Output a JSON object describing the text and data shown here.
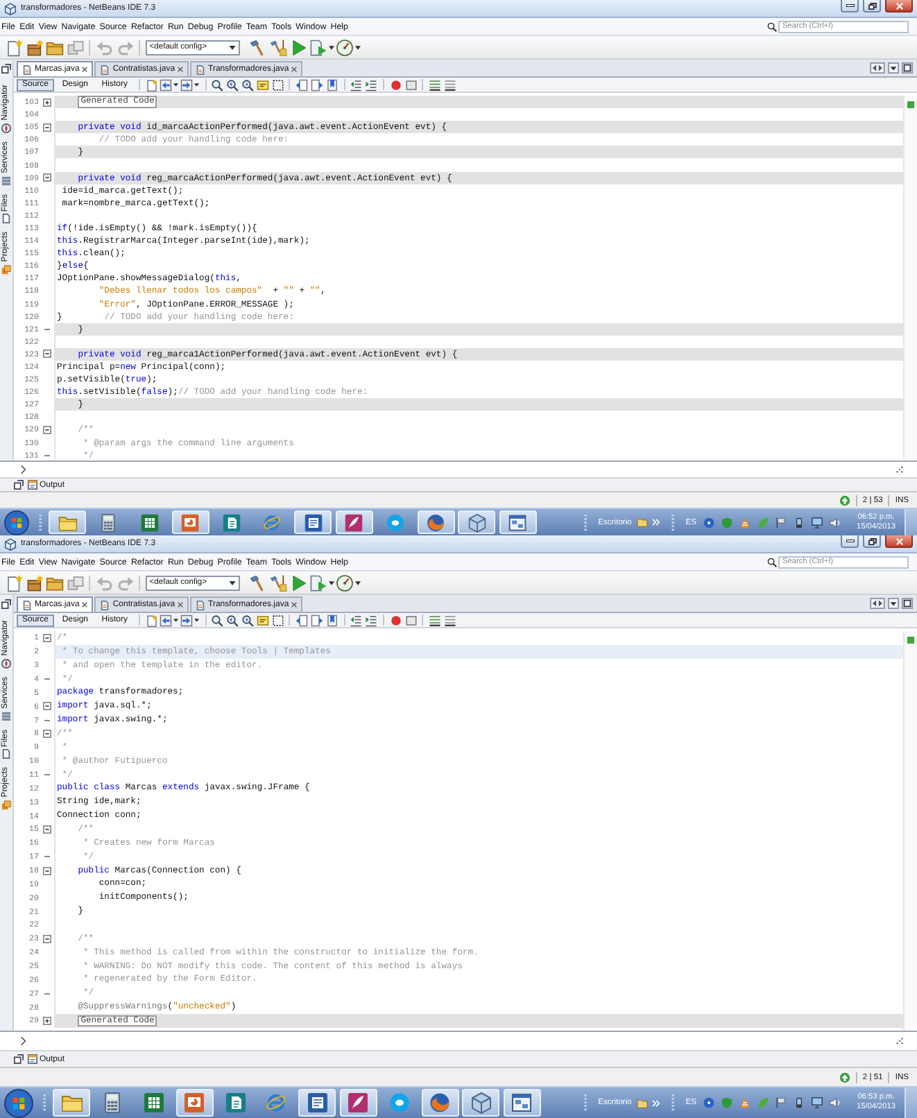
{
  "windows": [
    {
      "title": "transformadores - NetBeans IDE 7.3",
      "menu": [
        "File",
        "Edit",
        "View",
        "Navigate",
        "Source",
        "Refactor",
        "Run",
        "Debug",
        "Profile",
        "Team",
        "Tools",
        "Window",
        "Help"
      ],
      "search": {
        "placeholder": "Search (Ctrl+I)"
      },
      "config": "<default config>",
      "editor_tabs": [
        {
          "label": "Marcas.java",
          "selected": true
        },
        {
          "label": "Contratistas.java",
          "selected": false
        },
        {
          "label": "Transformadores.java",
          "selected": false
        }
      ],
      "views": [
        {
          "label": "Source",
          "selected": true
        },
        {
          "label": "Design",
          "selected": false
        },
        {
          "label": "History",
          "selected": false
        }
      ],
      "side_tabs": [
        "Navigator",
        "Services",
        "Files",
        "Projects"
      ],
      "code": [
        {
          "number": "103",
          "guarded": true,
          "fold": {
            "kind": "toggle",
            "expanded": false
          },
          "tokens": [
            {
              "kind": "folded",
              "text": "Generated Code"
            }
          ]
        },
        {
          "number": "104",
          "guarded": false
        },
        {
          "number": "105",
          "guarded": true,
          "fold": {
            "kind": "toggle",
            "expanded": true
          },
          "tokens": [
            {
              "kind": "keyword",
              "text": "    private void"
            },
            {
              "kind": "plain",
              "text": " id_marcaActionPerformed(java.awt.event.ActionEvent evt) {"
            }
          ]
        },
        {
          "number": "106",
          "guarded": false,
          "tokens": [
            {
              "kind": "comment",
              "text": "        // TODO add your handling code here:"
            }
          ]
        },
        {
          "number": "107",
          "guarded": true,
          "tokens": [
            {
              "kind": "plain",
              "text": "    }"
            }
          ]
        },
        {
          "number": "108",
          "guarded": false
        },
        {
          "number": "109",
          "guarded": true,
          "fold": {
            "kind": "toggle",
            "expanded": true
          },
          "tokens": [
            {
              "kind": "keyword",
              "text": "    private void"
            },
            {
              "kind": "plain",
              "text": " reg_marcaActionPerformed(java.awt.event.ActionEvent evt) {"
            }
          ]
        },
        {
          "number": "110",
          "guarded": false,
          "tokens": [
            {
              "kind": "plain",
              "text": " ide=id_marca.getText();"
            }
          ]
        },
        {
          "number": "111",
          "guarded": false,
          "tokens": [
            {
              "kind": "plain",
              "text": " mark=nombre_marca.getText();"
            }
          ]
        },
        {
          "number": "112",
          "guarded": false
        },
        {
          "number": "113",
          "guarded": false,
          "tokens": [
            {
              "kind": "keyword",
              "text": "if"
            },
            {
              "kind": "plain",
              "text": "(!ide.isEmpty() && !mark.isEmpty()){"
            }
          ]
        },
        {
          "number": "114",
          "guarded": false,
          "tokens": [
            {
              "kind": "keyword",
              "text": "this"
            },
            {
              "kind": "plain",
              "text": ".RegistrarMarca(Integer.parseInt(ide),mark);"
            }
          ]
        },
        {
          "number": "115",
          "guarded": false,
          "tokens": [
            {
              "kind": "keyword",
              "text": "this"
            },
            {
              "kind": "plain",
              "text": ".clean();"
            }
          ]
        },
        {
          "number": "116",
          "guarded": false,
          "tokens": [
            {
              "kind": "plain",
              "text": "}"
            },
            {
              "kind": "keyword",
              "text": "else"
            },
            {
              "kind": "plain",
              "text": "{"
            }
          ]
        },
        {
          "number": "117",
          "guarded": false,
          "tokens": [
            {
              "kind": "plain",
              "text": "JOptionPane.showMessageDialog("
            },
            {
              "kind": "keyword",
              "text": "this"
            },
            {
              "kind": "plain",
              "text": ","
            }
          ]
        },
        {
          "number": "118",
          "guarded": false,
          "tokens": [
            {
              "kind": "string",
              "text": "        \"Debes llenar todos los campos\""
            },
            {
              "kind": "plain",
              "text": "  + "
            },
            {
              "kind": "string",
              "text": "\"\""
            },
            {
              "kind": "plain",
              "text": " + "
            },
            {
              "kind": "string",
              "text": "\"\""
            },
            {
              "kind": "plain",
              "text": ","
            }
          ]
        },
        {
          "number": "119",
          "guarded": false,
          "tokens": [
            {
              "kind": "string",
              "text": "        \"Error\""
            },
            {
              "kind": "plain",
              "text": ", JOptionPane.ERROR_MESSAGE );"
            }
          ]
        },
        {
          "number": "120",
          "guarded": false,
          "tokens": [
            {
              "kind": "plain",
              "text": "}"
            },
            {
              "kind": "comment",
              "text": "        // TODO add your handling code here:"
            }
          ]
        },
        {
          "number": "121",
          "guarded": true,
          "fold": {
            "kind": "end"
          },
          "tokens": [
            {
              "kind": "plain",
              "text": "    }"
            }
          ]
        },
        {
          "number": "122",
          "guarded": false
        },
        {
          "number": "123",
          "guarded": true,
          "fold": {
            "kind": "toggle",
            "expanded": true
          },
          "tokens": [
            {
              "kind": "keyword",
              "text": "    private void"
            },
            {
              "kind": "plain",
              "text": " reg_marca1ActionPerformed(java.awt.event.ActionEvent evt) {"
            }
          ]
        },
        {
          "number": "124",
          "guarded": false,
          "tokens": [
            {
              "kind": "plain",
              "text": "Principal p="
            },
            {
              "kind": "keyword",
              "text": "new"
            },
            {
              "kind": "plain",
              "text": " Principal(conn);"
            }
          ]
        },
        {
          "number": "125",
          "guarded": false,
          "tokens": [
            {
              "kind": "plain",
              "text": "p.setVisible("
            },
            {
              "kind": "keyword",
              "text": "true"
            },
            {
              "kind": "plain",
              "text": ");"
            }
          ]
        },
        {
          "number": "126",
          "guarded": false,
          "tokens": [
            {
              "kind": "keyword",
              "text": "this"
            },
            {
              "kind": "plain",
              "text": ".setVisible("
            },
            {
              "kind": "keyword",
              "text": "false"
            },
            {
              "kind": "plain",
              "text": ");"
            },
            {
              "kind": "comment",
              "text": "// TODO add your handling code here:"
            }
          ]
        },
        {
          "number": "127",
          "guarded": true,
          "tokens": [
            {
              "kind": "plain",
              "text": "    }"
            }
          ]
        },
        {
          "number": "128",
          "guarded": false
        },
        {
          "number": "129",
          "guarded": false,
          "fold": {
            "kind": "toggle",
            "expanded": true
          },
          "tokens": [
            {
              "kind": "comment",
              "text": "    /**"
            }
          ]
        },
        {
          "number": "130",
          "guarded": false,
          "tokens": [
            {
              "kind": "comment",
              "text": "     * @param args the command line arguments"
            }
          ]
        },
        {
          "number": "131",
          "guarded": false,
          "fold": {
            "kind": "end"
          },
          "tokens": [
            {
              "kind": "comment",
              "text": "     */"
            }
          ]
        }
      ],
      "output_tab": "Output",
      "status_bar": {
        "position": "2 | 53",
        "mode": "INS"
      },
      "taskbar": {
        "apps": [
          {
            "running": true
          },
          {
            "running": false
          },
          {
            "running": false
          },
          {
            "running": true
          },
          {
            "running": false
          },
          {
            "running": false
          },
          {
            "running": true
          },
          {
            "running": true
          },
          {
            "running": false
          },
          {
            "running": true
          },
          {
            "running": true
          },
          {
            "running": true
          }
        ],
        "toolbar_label": "Escritorio",
        "language": "ES",
        "time": "06:52 p.m.",
        "date": "15/04/2013"
      }
    },
    {
      "title": "transformadores - NetBeans IDE 7.3",
      "menu": [
        "File",
        "Edit",
        "View",
        "Navigate",
        "Source",
        "Refactor",
        "Run",
        "Debug",
        "Profile",
        "Team",
        "Tools",
        "Window",
        "Help"
      ],
      "search": {
        "placeholder": "Search (Ctrl+I)"
      },
      "config": "<default config>",
      "editor_tabs": [
        {
          "label": "Marcas.java",
          "selected": true
        },
        {
          "label": "Contratistas.java",
          "selected": false
        },
        {
          "label": "Transformadores.java",
          "selected": false
        }
      ],
      "views": [
        {
          "label": "Source",
          "selected": true
        },
        {
          "label": "Design",
          "selected": false
        },
        {
          "label": "History",
          "selected": false
        }
      ],
      "side_tabs": [
        "Navigator",
        "Services",
        "Files",
        "Projects"
      ],
      "code": [
        {
          "number": "1",
          "guarded": false,
          "current": false,
          "fold": {
            "kind": "toggle",
            "expanded": true
          },
          "tokens": [
            {
              "kind": "comment",
              "text": "/*"
            }
          ]
        },
        {
          "number": "2",
          "guarded": false,
          "current": true,
          "tokens": [
            {
              "kind": "comment",
              "text": " * To change this template, choose Tools | Templates"
            }
          ]
        },
        {
          "number": "3",
          "guarded": false,
          "current": false,
          "tokens": [
            {
              "kind": "comment",
              "text": " * and open the template in the editor."
            }
          ]
        },
        {
          "number": "4",
          "guarded": false,
          "current": false,
          "fold": {
            "kind": "end"
          },
          "tokens": [
            {
              "kind": "comment",
              "text": " */"
            }
          ]
        },
        {
          "number": "5",
          "guarded": false,
          "current": false,
          "tokens": [
            {
              "kind": "keyword",
              "text": "package"
            },
            {
              "kind": "plain",
              "text": " transformadores;"
            }
          ]
        },
        {
          "number": "6",
          "guarded": false,
          "current": false,
          "fold": {
            "kind": "toggle",
            "expanded": true
          },
          "tokens": [
            {
              "kind": "keyword",
              "text": "import"
            },
            {
              "kind": "plain",
              "text": " java.sql.*;"
            }
          ]
        },
        {
          "number": "7",
          "guarded": false,
          "current": false,
          "fold": {
            "kind": "end"
          },
          "tokens": [
            {
              "kind": "keyword",
              "text": "import"
            },
            {
              "kind": "plain",
              "text": " javax.swing.*;"
            }
          ]
        },
        {
          "number": "8",
          "guarded": false,
          "current": false,
          "fold": {
            "kind": "toggle",
            "expanded": true
          },
          "tokens": [
            {
              "kind": "comment",
              "text": "/**"
            }
          ]
        },
        {
          "number": "9",
          "guarded": false,
          "current": false,
          "tokens": [
            {
              "kind": "comment",
              "text": " *"
            }
          ]
        },
        {
          "number": "10",
          "guarded": false,
          "current": false,
          "tokens": [
            {
              "kind": "comment",
              "text": " * @author Futipuerco"
            }
          ]
        },
        {
          "number": "11",
          "guarded": false,
          "current": false,
          "fold": {
            "kind": "end"
          },
          "tokens": [
            {
              "kind": "comment",
              "text": " */"
            }
          ]
        },
        {
          "number": "12",
          "guarded": false,
          "current": false,
          "tokens": [
            {
              "kind": "keyword",
              "text": "public class"
            },
            {
              "kind": "plain",
              "text": " Marcas "
            },
            {
              "kind": "keyword",
              "text": "extends"
            },
            {
              "kind": "plain",
              "text": " javax.swing.JFrame {"
            }
          ]
        },
        {
          "number": "13",
          "guarded": false,
          "current": false,
          "tokens": [
            {
              "kind": "plain",
              "text": "String ide,mark;"
            }
          ]
        },
        {
          "number": "14",
          "guarded": false,
          "current": false,
          "tokens": [
            {
              "kind": "plain",
              "text": "Connection conn;"
            }
          ]
        },
        {
          "number": "15",
          "guarded": false,
          "current": false,
          "fold": {
            "kind": "toggle",
            "expanded": true
          },
          "tokens": [
            {
              "kind": "comment",
              "text": "    /**"
            }
          ]
        },
        {
          "number": "16",
          "guarded": false,
          "current": false,
          "tokens": [
            {
              "kind": "comment",
              "text": "     * Creates new form Marcas"
            }
          ]
        },
        {
          "number": "17",
          "guarded": false,
          "current": false,
          "fold": {
            "kind": "end"
          },
          "tokens": [
            {
              "kind": "comment",
              "text": "     */"
            }
          ]
        },
        {
          "number": "18",
          "guarded": false,
          "current": false,
          "fold": {
            "kind": "toggle",
            "expanded": true
          },
          "tokens": [
            {
              "kind": "keyword",
              "text": "    public"
            },
            {
              "kind": "plain",
              "text": " Marcas(Connection con) {"
            }
          ]
        },
        {
          "number": "19",
          "guarded": false,
          "current": false,
          "tokens": [
            {
              "kind": "plain",
              "text": "        conn=con;"
            }
          ]
        },
        {
          "number": "20",
          "guarded": false,
          "current": false,
          "tokens": [
            {
              "kind": "plain",
              "text": "        initComponents();"
            }
          ]
        },
        {
          "number": "21",
          "guarded": false,
          "current": false,
          "tokens": [
            {
              "kind": "plain",
              "text": "    }"
            }
          ]
        },
        {
          "number": "22",
          "guarded": false,
          "current": false
        },
        {
          "number": "23",
          "guarded": false,
          "current": false,
          "fold": {
            "kind": "toggle",
            "expanded": true
          },
          "tokens": [
            {
              "kind": "comment",
              "text": "    /**"
            }
          ]
        },
        {
          "number": "24",
          "guarded": false,
          "current": false,
          "tokens": [
            {
              "kind": "comment",
              "text": "     * This method is called from within the constructor to initialize the form."
            }
          ]
        },
        {
          "number": "25",
          "guarded": false,
          "current": false,
          "tokens": [
            {
              "kind": "comment",
              "text": "     * WARNING: Do NOT modify this code. The content of this method is always"
            }
          ]
        },
        {
          "number": "26",
          "guarded": false,
          "current": false,
          "tokens": [
            {
              "kind": "comment",
              "text": "     * regenerated by the Form Editor."
            }
          ]
        },
        {
          "number": "27",
          "guarded": false,
          "current": false,
          "fold": {
            "kind": "end"
          },
          "tokens": [
            {
              "kind": "comment",
              "text": "     */"
            }
          ]
        },
        {
          "number": "28",
          "guarded": false,
          "current": false,
          "tokens": [
            {
              "kind": "annotation",
              "text": "    @SuppressWarnings"
            },
            {
              "kind": "plain",
              "text": "("
            },
            {
              "kind": "string",
              "text": "\"unchecked\""
            },
            {
              "kind": "plain",
              "text": ")"
            }
          ]
        },
        {
          "number": "29",
          "guarded": true,
          "current": false,
          "fold": {
            "kind": "toggle",
            "expanded": false
          },
          "tokens": [
            {
              "kind": "folded",
              "text": "Generated Code"
            }
          ]
        }
      ],
      "output_tab": "Output",
      "status_bar": {
        "position": "2 | 51",
        "mode": "INS"
      },
      "taskbar": {
        "apps": [
          {
            "running": true
          },
          {
            "running": false
          },
          {
            "running": false
          },
          {
            "running": true
          },
          {
            "running": false
          },
          {
            "running": false
          },
          {
            "running": true
          },
          {
            "running": true
          },
          {
            "running": false
          },
          {
            "running": true
          },
          {
            "running": true
          },
          {
            "running": true
          }
        ],
        "toolbar_label": "Escritorio",
        "language": "ES",
        "time": "06:53 p.m.",
        "date": "15/04/2013"
      }
    }
  ]
}
